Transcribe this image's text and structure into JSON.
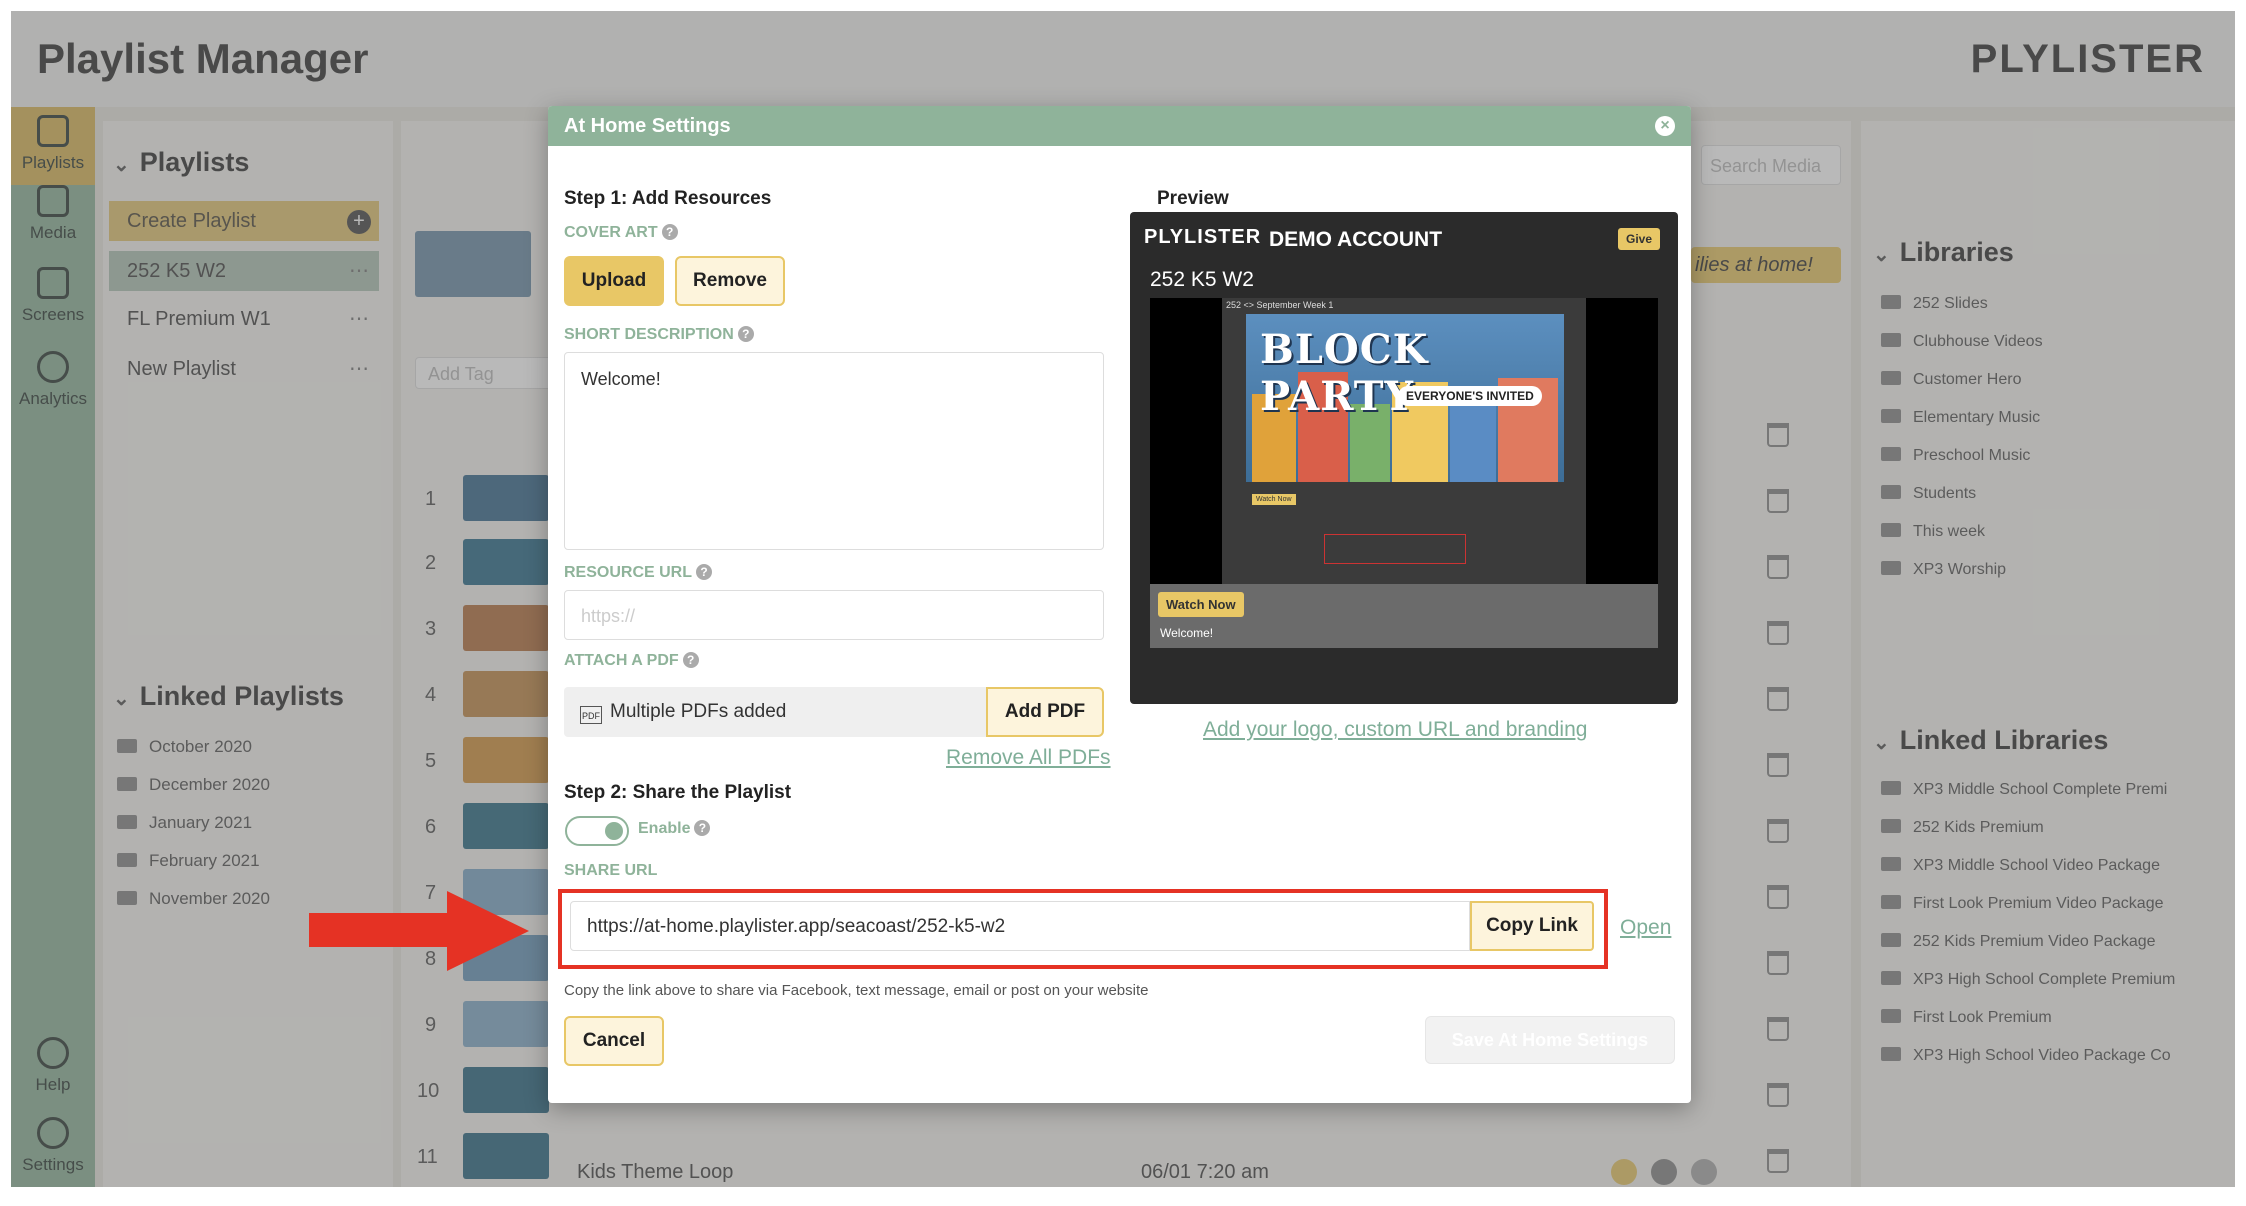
{
  "app": {
    "title": "Playlist Manager",
    "brand": "PLYLISTER"
  },
  "nav": {
    "items": [
      {
        "label": "Playlists",
        "icon": "playlists-icon"
      },
      {
        "label": "Media",
        "icon": "media-icon"
      },
      {
        "label": "Screens",
        "icon": "screens-icon"
      },
      {
        "label": "Analytics",
        "icon": "analytics-icon"
      },
      {
        "label": "Help",
        "icon": "help-icon"
      },
      {
        "label": "Settings",
        "icon": "settings-icon"
      }
    ]
  },
  "playlists": {
    "section_title": "Playlists",
    "create_label": "Create Playlist",
    "items": [
      "252 K5 W2",
      "FL Premium W1",
      "New Playlist"
    ],
    "linked_title": "Linked Playlists",
    "linked_items": [
      "October 2020",
      "December 2020",
      "January 2021",
      "February 2021",
      "November 2020"
    ]
  },
  "center": {
    "add_tag_placeholder": "Add Tag",
    "row_numbers": [
      "1",
      "2",
      "3",
      "4",
      "5",
      "6",
      "7",
      "8",
      "9",
      "10",
      "11"
    ],
    "last_row_title": "Kids Theme Loop",
    "last_row_date": "06/01 7:20 am",
    "search_placeholder": "Search Media",
    "families_badge": "ilies at home!"
  },
  "libraries": {
    "title": "Libraries",
    "items": [
      "252 Slides",
      "Clubhouse Videos",
      "Customer Hero",
      "Elementary Music",
      "Preschool Music",
      "Students",
      "This week",
      "XP3 Worship"
    ],
    "linked_title": "Linked Libraries",
    "linked_items": [
      "XP3 Middle School Complete Premi",
      "252 Kids Premium",
      "XP3 Middle School Video Package",
      "First Look Premium Video Package",
      "252 Kids Premium Video Package",
      "XP3 High School Complete Premium",
      "First Look Premium",
      "XP3 High School Video Package Co"
    ]
  },
  "modal": {
    "title": "At Home Settings",
    "step1": "Step 1: Add Resources",
    "cover_art_label": "COVER ART",
    "upload_label": "Upload",
    "remove_label": "Remove",
    "short_desc_label": "SHORT DESCRIPTION",
    "short_desc_value": "Welcome!",
    "resource_url_label": "RESOURCE URL",
    "resource_url_placeholder": "https://",
    "attach_pdf_label": "ATTACH A PDF",
    "pdf_status": "Multiple PDFs added",
    "add_pdf_label": "Add PDF",
    "remove_all_pdfs": "Remove All PDFs",
    "step2": "Step 2: Share the Playlist",
    "enable_label": "Enable",
    "share_url_label": "SHARE URL",
    "share_url_value": "https://at-home.playlister.app/seacoast/252-k5-w2",
    "copy_link_label": "Copy Link",
    "open_label": "Open",
    "hint": "Copy the link above to share via Facebook, text message, email or post on your website",
    "cancel_label": "Cancel",
    "save_label": "Save At Home Settings",
    "branding_link": "Add your logo, custom URL and branding",
    "preview_label": "Preview"
  },
  "preview": {
    "brand": "PLYLISTER",
    "account": "DEMO ACCOUNT",
    "give": "Give",
    "playlist_title": "252 K5 W2",
    "screen_title": "252 <> September Week 1",
    "poster_title": "BLOCK PARTY",
    "poster_sub": "EVERYONE'S INVITED",
    "watch_now": "Watch Now",
    "welcome": "Welcome!"
  },
  "colors": {
    "accent_green": "#8fb39a",
    "accent_yellow": "#e8c766",
    "highlight_red": "#e53224"
  }
}
